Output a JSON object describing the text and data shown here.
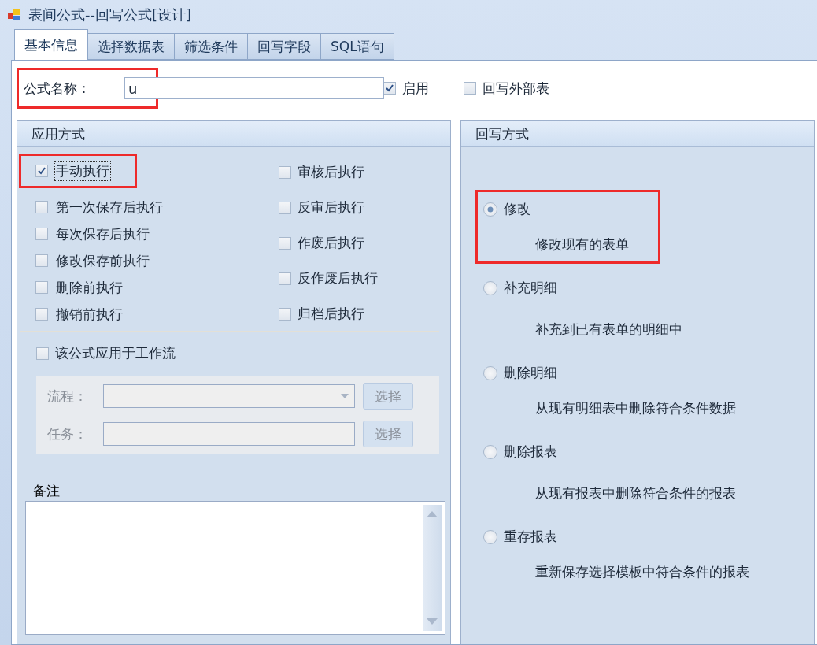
{
  "window": {
    "title": "表间公式--回写公式[设计]"
  },
  "tabs": [
    {
      "label": "基本信息",
      "selected": true
    },
    {
      "label": "选择数据表",
      "selected": false
    },
    {
      "label": "筛选条件",
      "selected": false
    },
    {
      "label": "回写字段",
      "selected": false
    },
    {
      "label": "SQL语句",
      "selected": false
    }
  ],
  "name_row": {
    "label": "公式名称：",
    "value": "u",
    "highlighted": true
  },
  "header_checks": [
    {
      "label": "启用",
      "checked": true
    },
    {
      "label": "回写外部表",
      "checked": false
    }
  ],
  "apply_group": {
    "title": "应用方式",
    "left_options": [
      {
        "label": "手动执行",
        "checked": true,
        "focused": true,
        "highlighted": true
      },
      {
        "label": "第一次保存后执行",
        "checked": false,
        "focused": false,
        "highlighted": false
      },
      {
        "label": "每次保存后执行",
        "checked": false,
        "focused": false,
        "highlighted": false
      },
      {
        "label": "修改保存前执行",
        "checked": false,
        "focused": false,
        "highlighted": false
      },
      {
        "label": "删除前执行",
        "checked": false,
        "focused": false,
        "highlighted": false
      },
      {
        "label": "撤销前执行",
        "checked": false,
        "focused": false,
        "highlighted": false
      }
    ],
    "right_options": [
      {
        "label": "审核后执行",
        "checked": false
      },
      {
        "label": "反审后执行",
        "checked": false
      },
      {
        "label": "作废后执行",
        "checked": false
      },
      {
        "label": "反作废后执行",
        "checked": false
      },
      {
        "label": "归档后执行",
        "checked": false
      }
    ],
    "workflow": {
      "label": "该公式应用于工作流",
      "checked": false
    },
    "workflow_fields": [
      {
        "kind": "combo",
        "label": "流程：",
        "button": "选择",
        "disabled": true
      },
      {
        "kind": "text",
        "label": "任务：",
        "button": "选择",
        "disabled": true
      }
    ],
    "remarks": {
      "title": "备注"
    }
  },
  "writeback_group": {
    "title": "回写方式",
    "options": [
      {
        "label": "修改",
        "description": "修改现有的表单",
        "selected": true,
        "highlighted": true
      },
      {
        "label": "补充明细",
        "description": "补充到已有表单的明细中",
        "selected": false,
        "highlighted": false
      },
      {
        "label": "删除明细",
        "description": "从现有明细表中删除符合条件数据",
        "selected": false,
        "highlighted": false
      },
      {
        "label": "删除报表",
        "description": "从现有报表中删除符合条件的报表",
        "selected": false,
        "highlighted": false
      },
      {
        "label": "重存报表",
        "description": "重新保存选择模板中符合条件的报表",
        "selected": false,
        "highlighted": false
      }
    ]
  }
}
